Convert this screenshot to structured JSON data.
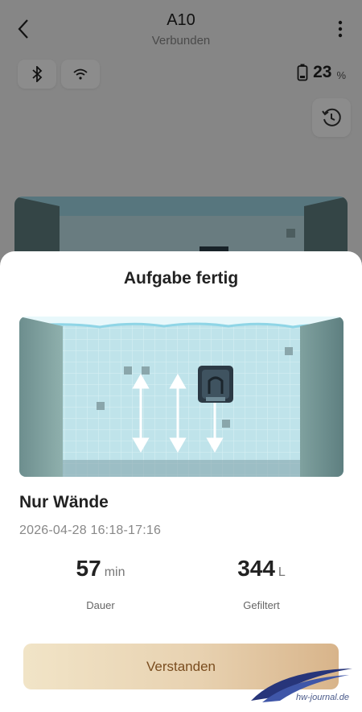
{
  "header": {
    "title": "A10",
    "subtitle": "Verbunden"
  },
  "status": {
    "battery_value": "23",
    "battery_unit": "%"
  },
  "dialog": {
    "title": "Aufgabe fertig",
    "mode": "Nur Wände",
    "datetime": "2026-04-28  16:18-17:16",
    "duration_value": "57",
    "duration_unit": "min",
    "duration_label": "Dauer",
    "filtered_value": "344",
    "filtered_unit": "L",
    "filtered_label": "Gefiltert",
    "confirm_label": "Verstanden"
  },
  "watermark": "hw-journal.de",
  "colors": {
    "button_gradient_start": "#f1e4c7",
    "button_gradient_end": "#d8b48a",
    "button_text": "#7a4d1f",
    "pool_water": "#bfe2ea",
    "wall": "#5f7f80"
  },
  "icons": [
    "back-arrow-icon",
    "more-vertical-icon",
    "bluetooth-icon",
    "wifi-icon",
    "battery-icon",
    "history-icon",
    "arrow-up-down-icon",
    "robot-icon"
  ]
}
